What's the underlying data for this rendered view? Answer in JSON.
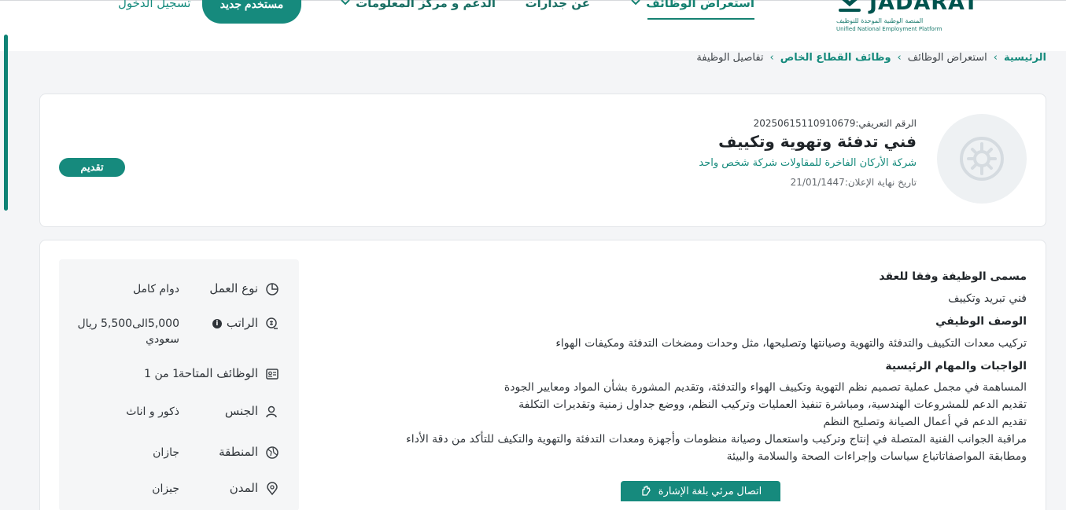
{
  "header": {
    "brand_name": "JADARAT",
    "brand_sub_ar": "المنصة الوطنية الموحدة للتوظيف",
    "brand_sub_en": "Unified National Employment Platform",
    "nav": {
      "jobs": "استعراض الوظائف",
      "about": "عن جدارات",
      "support": "الدعم و مركز المعلومات"
    },
    "new_user": "مستخدم جديد",
    "login": "تسجيل الدخول"
  },
  "breadcrumb": {
    "home": "الرئيسية",
    "jobs": "استعراض الوظائف",
    "private": "وظائف القطاع الخاص",
    "current": "تفاصيل الوظيفة",
    "separator": "›"
  },
  "job": {
    "ref_label": "الرقم التعريفي:",
    "ref_value": "20250615110910679",
    "title": "فني تدفئة وتهوية وتكييف",
    "company": "شركة الأركان الفاخرة للمقاولات شركة شخص واحد",
    "deadline_label": "تاريخ نهاية الإعلان:",
    "deadline_value": "21/01/1447",
    "apply": "تقديم"
  },
  "description": {
    "contract_title_heading": "مسمى الوظيفة وفقا للعقد",
    "contract_title": "فني تبريد وتكييف",
    "job_desc_heading": "الوصف الوظيفي",
    "job_desc": "تركيب معدات التكييف والتدفئة والتهوية وصيانتها وتصليحها، مثل وحدات ومضخات التدفئة ومكيفات الهواء",
    "duties_heading": "الواجبات والمهام الرئيسية",
    "duties": [
      "المساهمة في مجمل عملية تصميم نظم التهوية وتكييف الهواء والتدفئة، وتقديم المشورة بشأن المواد ومعايير الجودة",
      "تقديم الدعم للمشروعات الهندسية، ومباشرة تنفيذ العمليات وتركيب النظم، ووضع جداول زمنية وتقديرات التكلفة",
      "تقديم الدعم في أعمال الصيانة وتصليح النظم",
      "مراقبة الجوانب الفنية المتصلة في إنتاج وتركيب واستعمال وصيانة منظومات وأجهزة ومعدات التدفئة والتهوية  والتكيف  للتأكد من دقة الأداء",
      "ومطابقة المواصفاتاتباع سياسات وإجراءات الصحة والسلامة والبيئة"
    ]
  },
  "info": {
    "work_type_label": "نوع العمل",
    "work_type_value": "دوام كامل",
    "salary_label": "الراتب",
    "salary_value": "5,000الى5,500 ريال سعودي",
    "salary_info_glyph": "i",
    "vacancies_label": "الوظائف المتاحة",
    "vacancies_value": "1 من 1",
    "gender_label": "الجنس",
    "gender_value": "ذكور و اناث",
    "region_label": "المنطقة",
    "region_value": "جازان",
    "city_label": "المدن",
    "city_value": "جيزان"
  },
  "sign_language": "اتصال مرئي بلغة الإشارة",
  "colors": {
    "primary": "#168a7d",
    "brand": "#00544f"
  }
}
